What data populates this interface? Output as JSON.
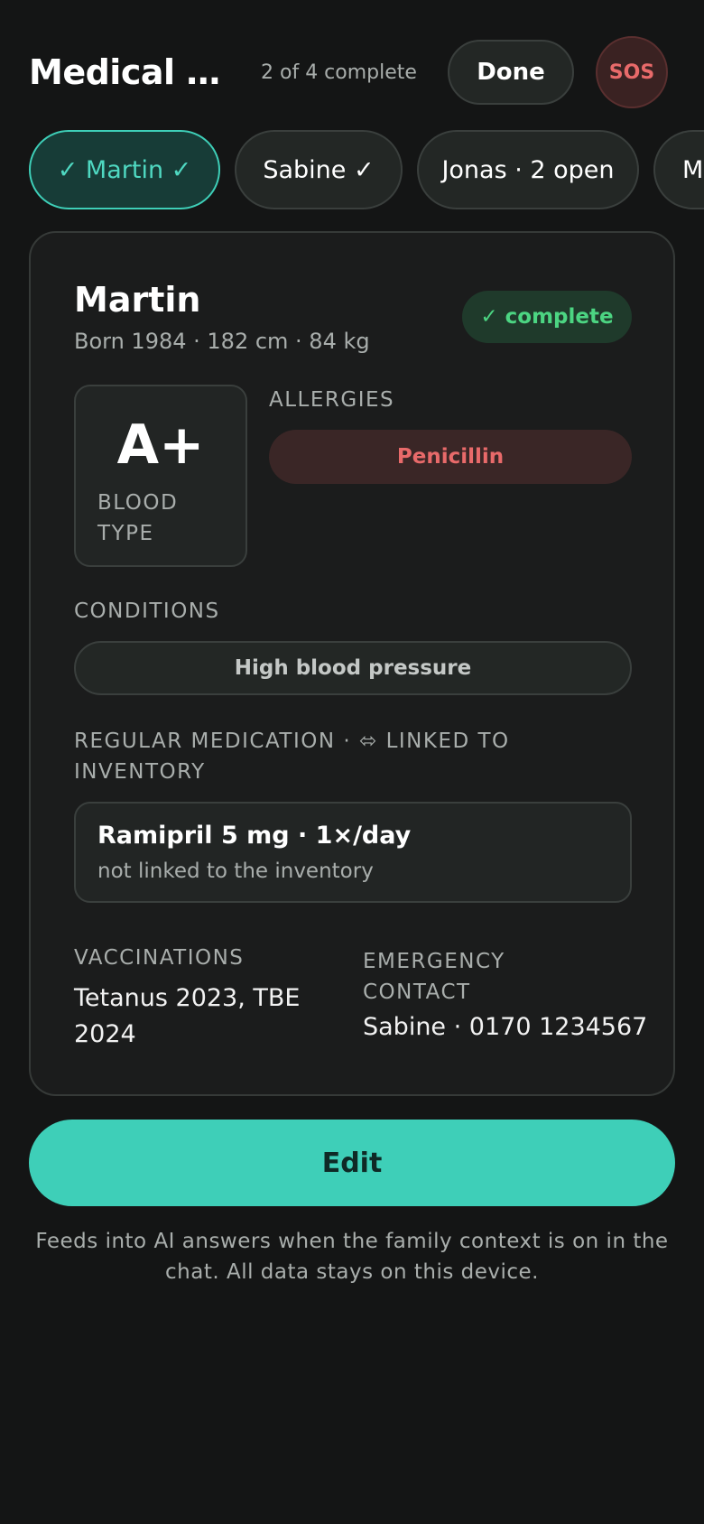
{
  "header": {
    "title": "Medical c...",
    "progress": "2 of 4 complete",
    "done_label": "Done",
    "sos_label": "SOS"
  },
  "members": [
    {
      "label": "✓ Martin ✓",
      "active": true
    },
    {
      "label": "Sabine ✓",
      "active": false
    },
    {
      "label": "Jonas · 2 open",
      "active": false
    },
    {
      "label": "M",
      "active": false
    }
  ],
  "card": {
    "name": "Martin",
    "meta": "Born 1984 · 182 cm · 84 kg",
    "status_badge": "✓ complete",
    "blood_type": {
      "value": "A+",
      "label": "BLOOD TYPE"
    },
    "allergies": {
      "label": "ALLERGIES",
      "items": [
        "Penicillin"
      ]
    },
    "conditions": {
      "label": "CONDITIONS",
      "items": [
        "High blood pressure"
      ]
    },
    "medication": {
      "label": "REGULAR MEDICATION · ⬄ LINKED TO INVENTORY",
      "items": [
        {
          "name": "Ramipril 5 mg · 1×/day",
          "note": "not linked to the inventory"
        }
      ]
    },
    "vaccinations": {
      "label": "VACCINATIONS",
      "value": "Tetanus 2023, TBE 2024"
    },
    "emergency_contact": {
      "label": "EMERGENCY CONTACT",
      "value": "Sabine · 0170 1234567"
    }
  },
  "edit_label": "Edit",
  "footer_note": "Feeds into AI answers when the family context is on in the chat. All data stays on this device.",
  "colors": {
    "background": "#141515",
    "accent": "#3ecfb8",
    "complete_green": "#4cd582",
    "danger_red": "#e86a6a"
  }
}
